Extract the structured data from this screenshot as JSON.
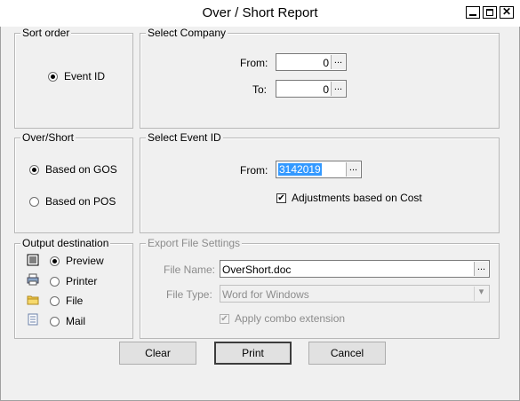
{
  "window": {
    "title": "Over / Short Report"
  },
  "sort_order": {
    "legend": "Sort order",
    "option": "Event ID"
  },
  "select_company": {
    "legend": "Select Company",
    "from_label": "From:",
    "from_value": "0",
    "to_label": "To:",
    "to_value": "0",
    "browse": "..."
  },
  "over_short": {
    "legend": "Over/Short",
    "options": [
      "Based on GOS",
      "Based on POS"
    ],
    "selected": "Based on GOS"
  },
  "select_event": {
    "legend": "Select Event ID",
    "from_label": "From:",
    "from_value": "3142019",
    "browse": "...",
    "adjustments_label": "Adjustments based on Cost",
    "adjustments_checked": true
  },
  "output_destination": {
    "legend": "Output destination",
    "options": [
      "Preview",
      "Printer",
      "File",
      "Mail"
    ],
    "selected": "Preview",
    "icons": [
      "preview-icon",
      "printer-icon",
      "file-icon",
      "mail-icon"
    ]
  },
  "export_settings": {
    "legend": "Export  File Settings",
    "file_name_label": "File Name:",
    "file_name_value": "OverShort.doc",
    "browse": "...",
    "file_type_label": "File Type:",
    "file_type_value": "Word for Windows",
    "apply_combo_label": "Apply combo extension",
    "apply_combo_checked": true
  },
  "buttons": {
    "clear": "Clear",
    "print": "Print",
    "cancel": "Cancel"
  },
  "colors": {
    "selection": "#3399ff",
    "window_bg": "#f0f0f0"
  }
}
